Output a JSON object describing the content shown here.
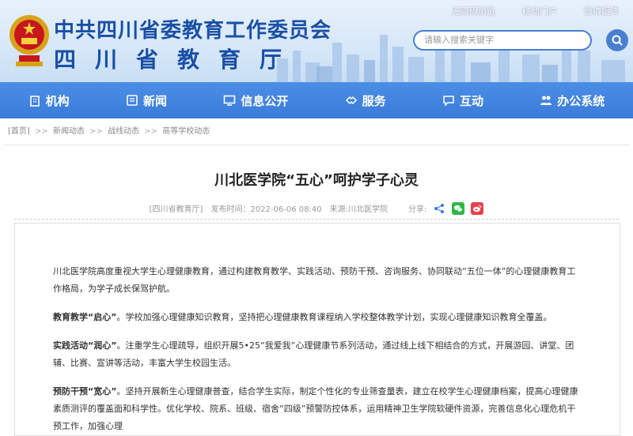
{
  "header": {
    "title_cn": "中共四川省委教育工作委员会",
    "title_sub": "四川省教育厅",
    "top_links": [
      "无障碍浏览",
      "移动门户",
      "微博矩阵"
    ],
    "search_placeholder": "请输入搜索关键字"
  },
  "nav": [
    {
      "label": "机构",
      "icon": "building-icon"
    },
    {
      "label": "新闻",
      "icon": "newspaper-icon"
    },
    {
      "label": "信息公开",
      "icon": "monitor-icon"
    },
    {
      "label": "服务",
      "icon": "handshake-icon"
    },
    {
      "label": "互动",
      "icon": "chat-icon"
    },
    {
      "label": "办公系统",
      "icon": "users-icon"
    }
  ],
  "breadcrumb": [
    "[首页]",
    "新闻动态",
    "战线动态",
    "高等学校动态"
  ],
  "breadcrumb_sep": ">>",
  "article": {
    "title": "川北医学院“五心”呵护学子心灵",
    "source_tag": "[四川省教育厅]",
    "publish_time": "发布时间：2022-06-06 08:40",
    "origin": "来源:川北医学院",
    "share_label": "分享:",
    "paragraphs": [
      {
        "lead": "",
        "text": "川北医学院高度重视大学生心理健康教育，通过构建教育教学、实践活动、预防干预、咨询服务、协同联动“五位一体”的心理健康教育工作格局，为学子成长保驾护航。"
      },
      {
        "lead": "教育教学“启心”",
        "text": "。学校加强心理健康知识教育，坚持把心理健康教育课程纳入学校整体教学计划，实现心理健康知识教育全覆盖。"
      },
      {
        "lead": "实践活动“润心”",
        "text": "。注重学生心理疏导，组织开展5•25“我爱我”心理健康节系列活动，通过线上线下相结合的方式，开展游园、讲堂、团辅、比赛、宣讲等活动，丰富大学生校园生活。"
      },
      {
        "lead": "预防干预“宽心”",
        "text": "。坚持开展新生心理健康普查，结合学生实际，制定个性化的专业筛查量表，建立在校学生心理健康档案，提高心理健康素质测评的覆盖面和科学性。优化学校、院系、班级、宿舍“四级”预警防控体系，运用精神卫生学院软硬件资源，完善信息化心理危机干预工作，加强心理"
      }
    ]
  },
  "colors": {
    "primary": "#1a4fa5",
    "nav": "#3a7bd8",
    "wechat": "#2fb744",
    "weibo": "#e6424b",
    "share": "#3a7bd8"
  }
}
